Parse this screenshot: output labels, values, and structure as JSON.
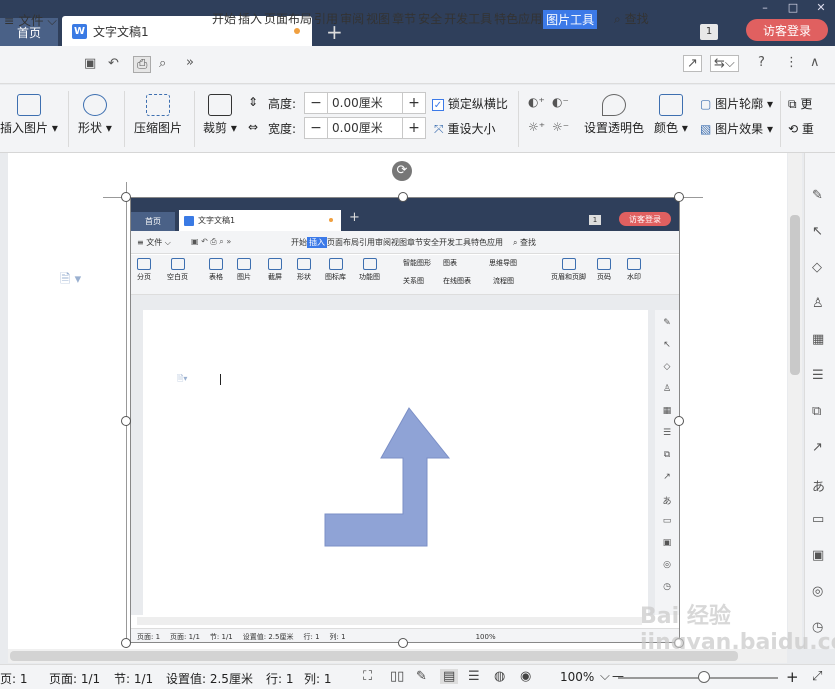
{
  "tabs": {
    "home": "首页",
    "doc": "文字文稿1",
    "new": "+"
  },
  "window": {
    "minimize": "–",
    "maximize": "□",
    "close": "✕"
  },
  "header": {
    "badge": "1",
    "login": "访客登录"
  },
  "menu": {
    "file": "≡ 文件 ⌵",
    "more": "»",
    "items": [
      "开始",
      "插入",
      "页面布局",
      "引用",
      "审阅",
      "视图",
      "章节",
      "安全",
      "开发工具",
      "特色应用",
      "图片工具"
    ],
    "active_index": 10,
    "search": "查找"
  },
  "ribbon": {
    "insert_picture": "插入图片",
    "shape": "形状",
    "compress": "压缩图片",
    "crop": "裁剪",
    "height_label": "高度:",
    "width_label": "宽度:",
    "height_value": "0.00厘米",
    "width_value": "0.00厘米",
    "lock_ratio": "锁定纵横比",
    "reset_size": "重设大小",
    "set_transparent": "设置透明色",
    "color": "颜色",
    "outline": "图片轮廓",
    "effect": "图片效果",
    "more1": "更",
    "more2": "重"
  },
  "inner": {
    "home": "首页",
    "doc": "文字文稿1",
    "login": "访客登录",
    "badge": "1",
    "file": "≡ 文件 ⌵",
    "menu_items": [
      "开始",
      "插入",
      "页面布局",
      "引用",
      "审阅",
      "视图",
      "章节",
      "安全",
      "开发工具",
      "特色应用"
    ],
    "active_index": 1,
    "search": "查找",
    "ribbon": [
      "分页",
      "空白页",
      "表格",
      "图片",
      "截屏",
      "形状",
      "图标库",
      "功能图",
      "智能图形",
      "图表",
      "思维导图",
      "关系图",
      "在线图表",
      "流程图",
      "页眉和页脚",
      "页码",
      "水印"
    ],
    "status": [
      "页面: 1",
      "页面: 1/1",
      "节: 1/1",
      "设置值: 2.5厘米",
      "行: 1",
      "列: 1"
    ],
    "zoom": "100%"
  },
  "status": {
    "page": "页: 1",
    "pages": "页面: 1/1",
    "section": "节: 1/1",
    "setting": "设置值: 2.5厘米",
    "row": "行: 1",
    "col": "列: 1",
    "zoom": "100%",
    "minus": "—",
    "plus": "+"
  },
  "watermark": "Bai 经验 jingyan.baidu.com"
}
